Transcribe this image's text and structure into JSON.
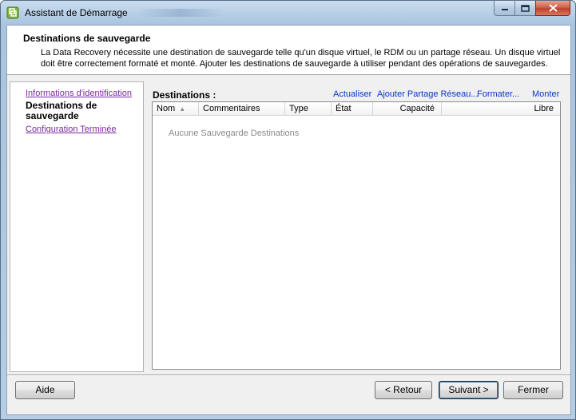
{
  "window": {
    "title": "Assistant de Démarrage"
  },
  "header": {
    "title": "Destinations de sauvegarde",
    "description": "La Data Recovery nécessite une destination de sauvegarde telle qu'un disque virtuel, le RDM ou un partage réseau. Un disque virtuel doit être correctement formaté et monté.  Ajouter les destinations de sauvegarde à utiliser pendant des opérations de sauvegardes."
  },
  "nav": {
    "items": [
      {
        "label": "Informations d'identification",
        "state": "link"
      },
      {
        "label": "Destinations de sauvegarde",
        "state": "current"
      },
      {
        "label": "Configuration Terminée",
        "state": "link"
      }
    ]
  },
  "destinations": {
    "label": "Destinations :",
    "actions": {
      "refresh": "Actualiser",
      "add_share": "Ajouter Partage Réseau...",
      "format": "Formater...",
      "mount": "Monter"
    },
    "columns": [
      "Nom",
      "Commentaires",
      "Type",
      "État",
      "Capacité",
      "Libre"
    ],
    "sorted_column": "Nom",
    "empty_message": "Aucune Sauvegarde Destinations"
  },
  "footer": {
    "help": "Aide",
    "back": "< Retour",
    "next": "Suivant >",
    "close": "Fermer"
  },
  "icons": {
    "app": "vsphere-icon",
    "minimize": "minimize-icon",
    "maximize": "maximize-icon",
    "close": "close-icon",
    "sort": "sort-ascending-icon"
  }
}
